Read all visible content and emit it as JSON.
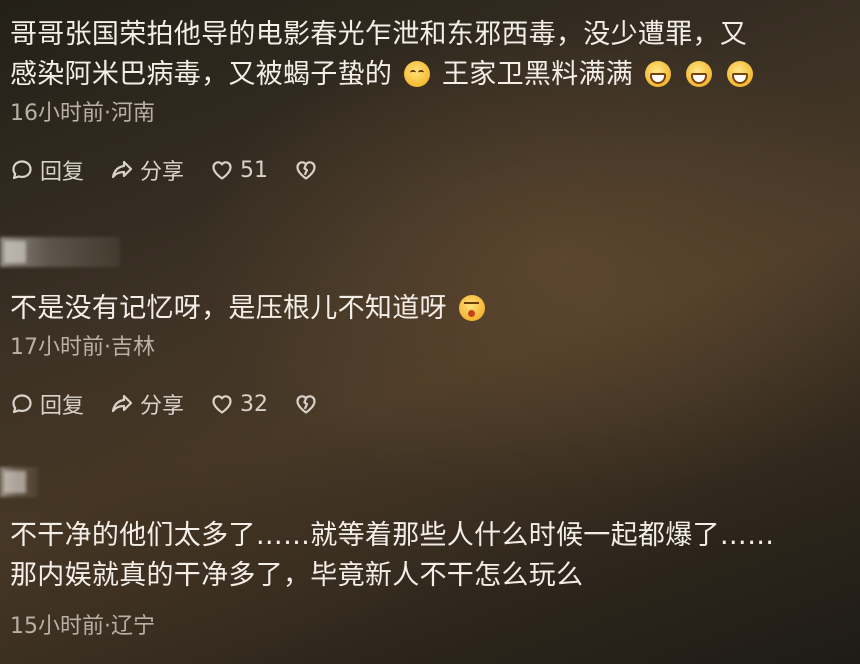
{
  "comments": [
    {
      "text_lines": [
        "哥哥张国荣拍他导的电影春光乍泄和东邪西毒，没少遭罪，又",
        "感染阿米巴病毒，又被蝎子蛰的",
        "王家卫黑料满满"
      ],
      "emojis": [
        "smile-emoji",
        "grin-emoji",
        "grin-emoji",
        "grin-emoji"
      ],
      "meta": "16小时前·河南",
      "reply_label": "回复",
      "share_label": "分享",
      "like_count": "51"
    },
    {
      "text_lines": [
        "不是没有记忆呀，是压根儿不知道呀"
      ],
      "emojis": [
        "blush-emoji"
      ],
      "meta": "17小时前·吉林",
      "reply_label": "回复",
      "share_label": "分享",
      "like_count": "32"
    },
    {
      "text_lines": [
        "不干净的他们太多了……就等着那些人什么时候一起都爆了……",
        "那内娱就真的干净多了，毕竟新人不干怎么玩么"
      ],
      "emojis": [],
      "meta": "15小时前·辽宁"
    }
  ]
}
